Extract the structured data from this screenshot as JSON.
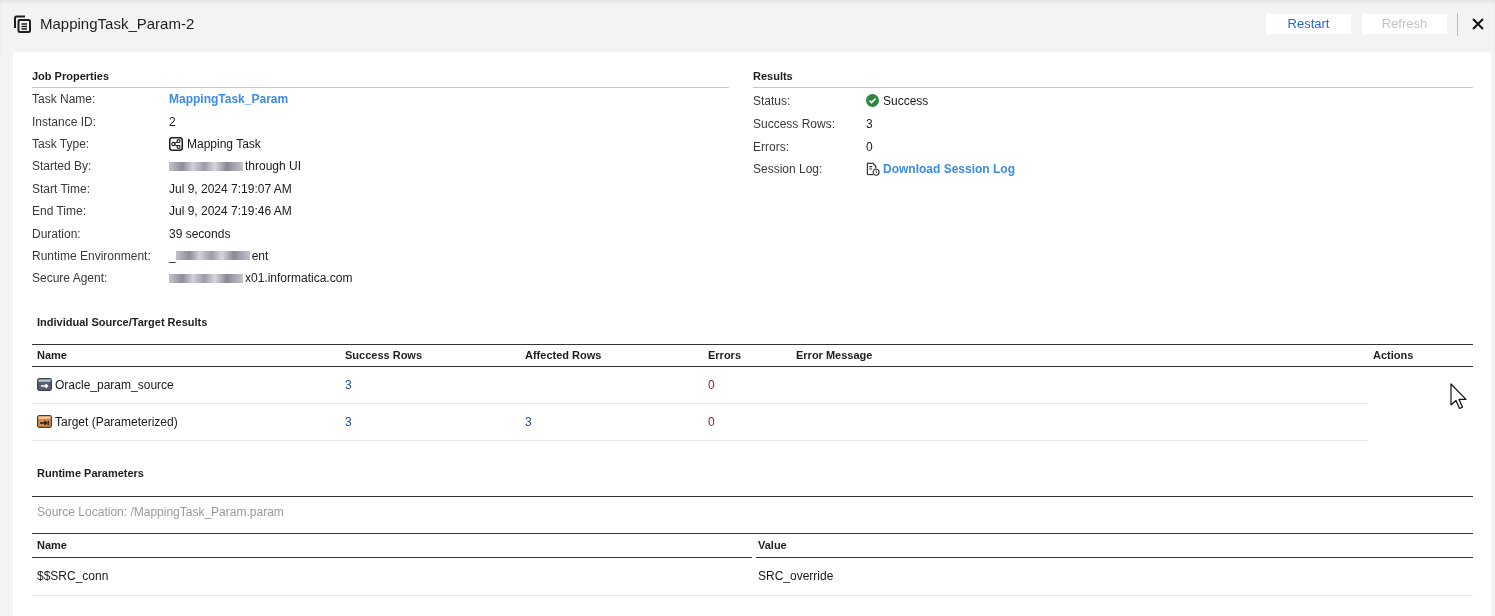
{
  "header": {
    "title": "MappingTask_Param-2",
    "buttons": [
      {
        "label": "Restart",
        "disabled": false
      },
      {
        "label": "Refresh",
        "disabled": true
      }
    ]
  },
  "job_properties": {
    "title": "Job Properties",
    "rows": [
      {
        "label": "Task Name:",
        "kind": "link",
        "value": "MappingTask_Param"
      },
      {
        "label": "Instance ID:",
        "kind": "text",
        "value": "2"
      },
      {
        "label": "Task Type:",
        "kind": "task_type",
        "value": "Mapping Task"
      },
      {
        "label": "Started By:",
        "kind": "parts",
        "parts": [
          {
            "kind": "redacted"
          },
          {
            "kind": "text",
            "text": "through UI"
          }
        ]
      },
      {
        "label": "Start Time:",
        "kind": "text",
        "value": "Jul 9, 2024 7:19:07 AM"
      },
      {
        "label": "End Time:",
        "kind": "text",
        "value": "Jul 9, 2024 7:19:46 AM"
      },
      {
        "label": "Duration:",
        "kind": "text",
        "value": "39 seconds"
      },
      {
        "label": "Runtime Environment:",
        "kind": "parts",
        "parts": [
          {
            "kind": "text",
            "text": "_"
          },
          {
            "kind": "redacted"
          },
          {
            "kind": "text",
            "text": "ent"
          }
        ]
      },
      {
        "label": "Secure Agent:",
        "kind": "parts",
        "parts": [
          {
            "kind": "redacted"
          },
          {
            "kind": "text",
            "text": "x01.informatica.com"
          }
        ]
      }
    ]
  },
  "results": {
    "title": "Results",
    "rows": [
      {
        "label": "Status:",
        "kind": "status_success",
        "value": "Success"
      },
      {
        "label": "Success Rows:",
        "kind": "text",
        "value": "3"
      },
      {
        "label": "Errors:",
        "kind": "text",
        "value": "0"
      },
      {
        "label": "Session Log:",
        "kind": "download_link",
        "value": "Download Session Log"
      }
    ]
  },
  "source_target_results": {
    "title": "Individual Source/Target Results",
    "columns": [
      "Name",
      "Success Rows",
      "Affected Rows",
      "Errors",
      "Error Message",
      "Actions"
    ],
    "rows": [
      {
        "kind": "source",
        "name": "Oracle_param_source",
        "success_rows": "3",
        "errors": "0"
      },
      {
        "kind": "target",
        "name": "Target (Parameterized)",
        "success_rows": "3",
        "affected_rows": "3",
        "errors": "0"
      }
    ]
  },
  "runtime_parameters": {
    "title": "Runtime Parameters",
    "source_location": "Source Location: /MappingTask_Param.param",
    "columns": [
      "Name",
      "Value"
    ],
    "rows": [
      {
        "name": "$$SRC_conn",
        "value": "SRC_override"
      }
    ]
  }
}
